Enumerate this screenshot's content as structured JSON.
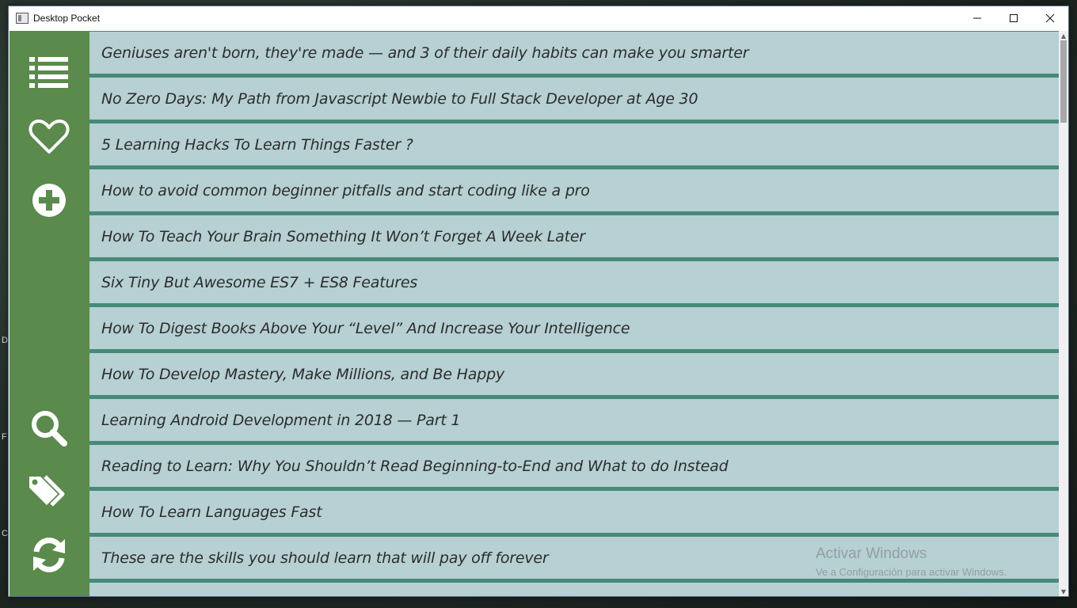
{
  "window": {
    "title": "Desktop Pocket",
    "minimize": "—",
    "maximize": "☐",
    "close": "✕"
  },
  "desktop_fragments": [
    "D",
    "F",
    "C"
  ],
  "sidebar": {
    "top_buttons": [
      {
        "name": "list",
        "icon": "list-icon"
      },
      {
        "name": "favorites",
        "icon": "heart-icon"
      },
      {
        "name": "add",
        "icon": "add-circle-icon"
      }
    ],
    "bottom_buttons": [
      {
        "name": "search",
        "icon": "search-icon"
      },
      {
        "name": "tags",
        "icon": "tags-icon"
      },
      {
        "name": "refresh",
        "icon": "refresh-icon"
      }
    ]
  },
  "articles": [
    "Geniuses aren't born, they're made — and 3 of their daily habits can make you smarter",
    "No Zero Days: My Path from Javascript Newbie to Full Stack Developer at Age 30",
    "5 Learning Hacks To Learn Things Faster ?",
    "How to avoid common beginner pitfalls and start coding like a pro",
    "How To Teach Your Brain Something It Won’t Forget A Week Later",
    "Six Tiny But Awesome ES7 + ES8 Features",
    "How To Digest Books Above Your “Level” And Increase Your Intelligence",
    "How To Develop Mastery, Make Millions, and Be Happy",
    "Learning Android Development in 2018 — Part 1",
    "Reading to Learn: Why You Shouldn’t Read Beginning-to-End and What to do Instead",
    "How To Learn Languages Fast",
    "These are the skills you should learn that will pay off forever"
  ],
  "watermark": {
    "title": "Activar Windows",
    "subtitle": "Ve a Configuración para activar Windows."
  },
  "colors": {
    "sidebar": "#5a8a4c",
    "item_bg": "#b6d0d3",
    "separator": "#468a78"
  }
}
